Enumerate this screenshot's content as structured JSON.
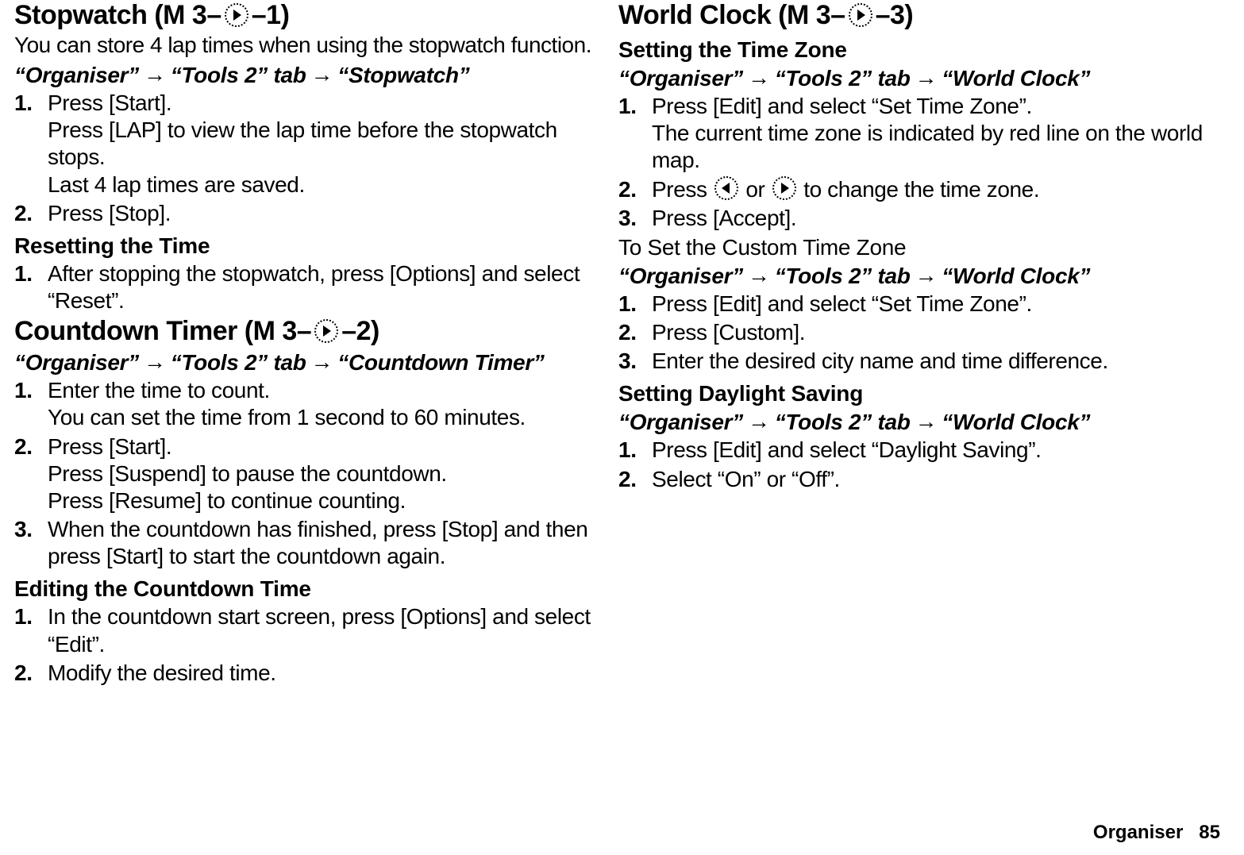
{
  "left": {
    "stopwatch": {
      "title_pre": "Stopwatch (M 3–",
      "title_post": "–1)",
      "intro": "You can store 4 lap times when using the stopwatch function.",
      "path_a": "“Organiser”",
      "path_b": "“Tools 2” tab",
      "path_c": "“Stopwatch”",
      "steps": [
        {
          "main": "Press [Start].",
          "sub1": "Press [LAP] to view the lap time before the stopwatch stops.",
          "sub2": "Last 4 lap times are saved."
        },
        {
          "main": "Press [Stop]."
        }
      ],
      "reset_heading": "Resetting the Time",
      "reset_steps": [
        {
          "main": "After stopping the stopwatch, press [Options] and select “Reset”."
        }
      ]
    },
    "countdown": {
      "title_pre": "Countdown Timer (M 3–",
      "title_post": "–2)",
      "path_a": "“Organiser”",
      "path_b": "“Tools 2” tab",
      "path_c": "“Countdown Timer”",
      "steps": [
        {
          "main": "Enter the time to count.",
          "sub1": "You can set the time from 1 second to 60 minutes."
        },
        {
          "main": "Press [Start].",
          "sub1": "Press [Suspend] to pause the countdown.",
          "sub2": "Press [Resume] to continue counting."
        },
        {
          "main": "When the countdown has finished, press [Stop] and then press [Start] to start the countdown again."
        }
      ],
      "edit_heading": "Editing the Countdown Time",
      "edit_steps": [
        {
          "main": "In the countdown start screen, press [Options] and select “Edit”."
        },
        {
          "main": "Modify the desired time."
        }
      ]
    }
  },
  "right": {
    "worldclock": {
      "title_pre": "World Clock (M 3–",
      "title_post": "–3)",
      "tz_heading": "Setting the Time Zone",
      "path_a": "“Organiser”",
      "path_b": "“Tools 2” tab",
      "path_c": "“World Clock”",
      "tz_steps": [
        {
          "main": "Press [Edit] and select “Set Time Zone”.",
          "sub1": "The current time zone is indicated by red line on the world map."
        },
        {
          "main_pre": "Press ",
          "main_mid": " or ",
          "main_post": " to change the time zone."
        },
        {
          "main": "Press [Accept]."
        }
      ],
      "custom_note": "To Set the Custom Time Zone",
      "custom_steps": [
        {
          "main": "Press [Edit] and select “Set Time Zone”."
        },
        {
          "main": "Press [Custom]."
        },
        {
          "main": "Enter the desired city name and time difference."
        }
      ],
      "dst_heading": "Setting Daylight Saving",
      "dst_steps": [
        {
          "main": "Press [Edit] and select “Daylight Saving”."
        },
        {
          "main": "Select “On” or “Off”."
        }
      ]
    }
  },
  "footer": {
    "chapter": "Organiser",
    "page": "85"
  }
}
